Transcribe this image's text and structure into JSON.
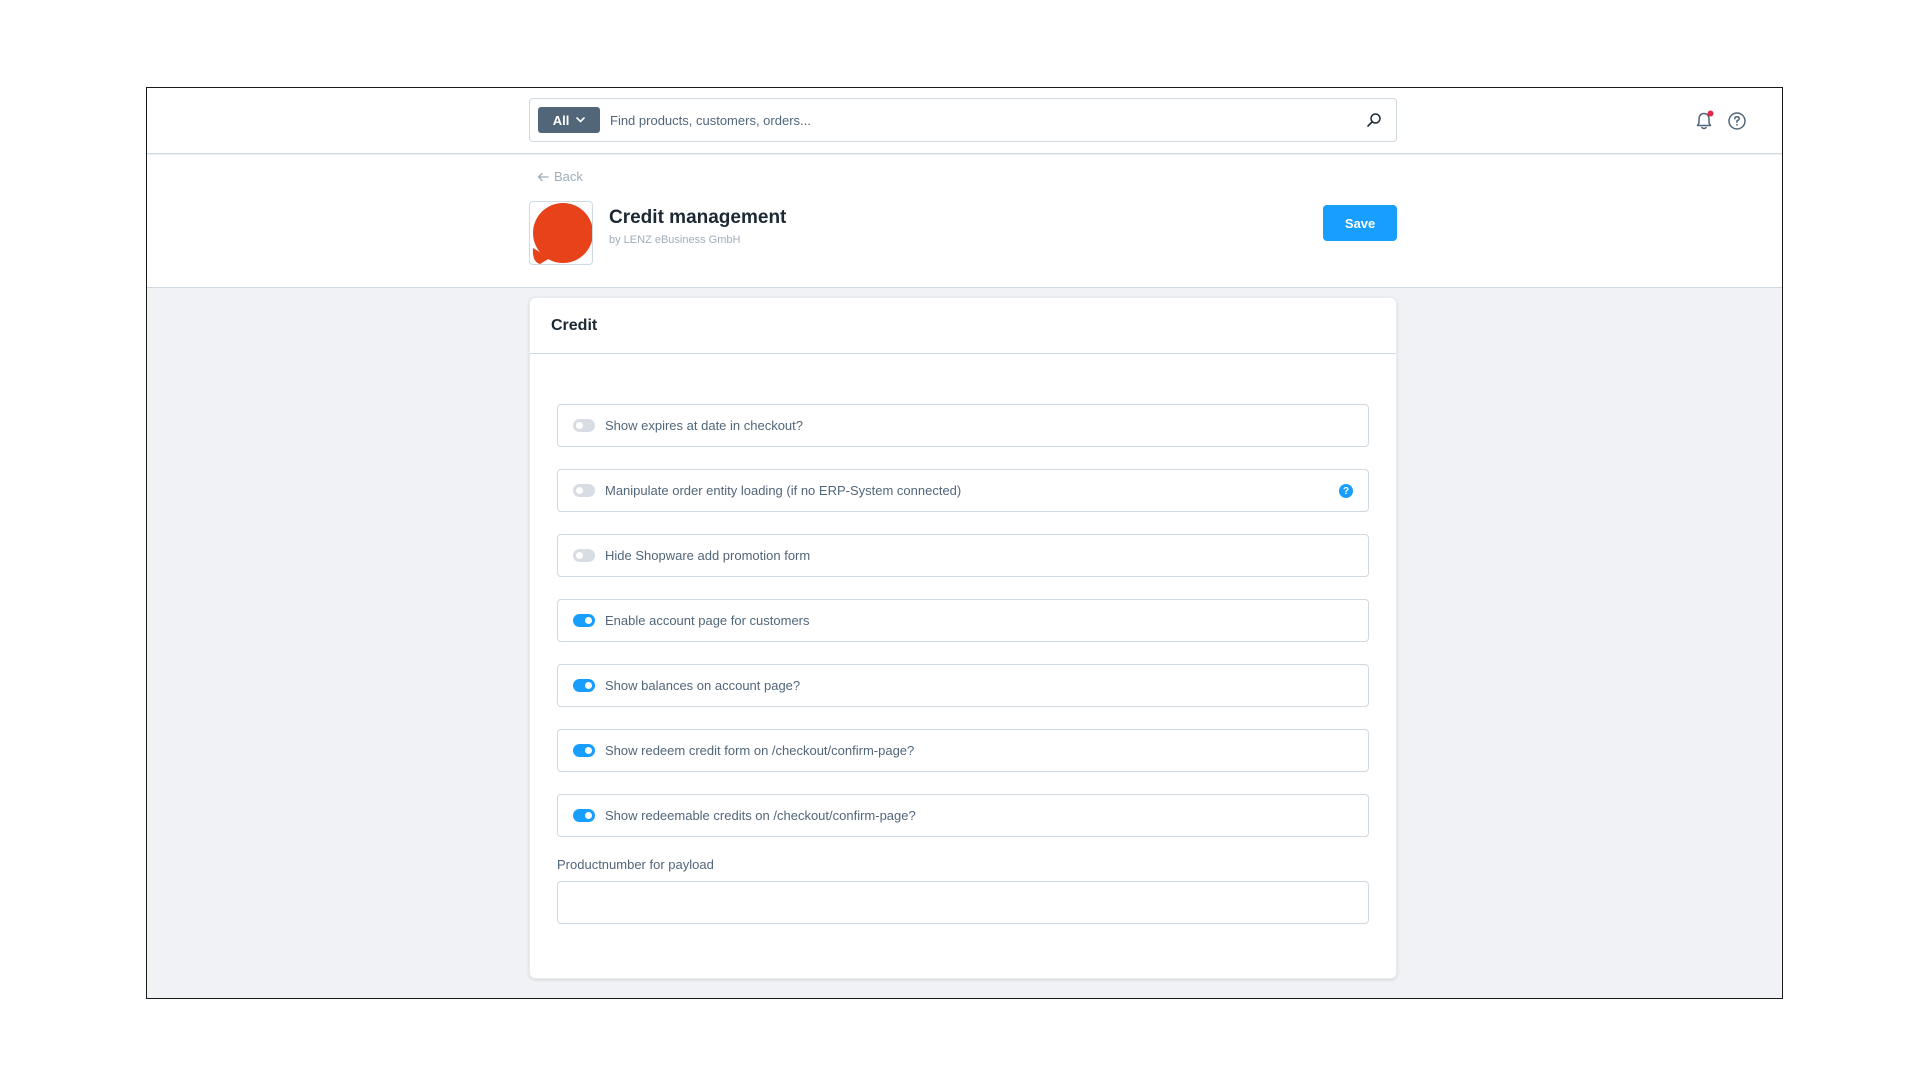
{
  "topbar": {
    "search_type": "All",
    "search_placeholder": "Find products, customers, orders...",
    "notification_dot_color": "#de294c"
  },
  "header": {
    "back_label": "Back",
    "title": "Credit management",
    "subtitle": "by LENZ eBusiness GmbH",
    "save_label": "Save",
    "logo_color": "#e8421a"
  },
  "card": {
    "title": "Credit",
    "switches": [
      {
        "label": "Show expires at date in checkout?",
        "enabled": false,
        "help": false
      },
      {
        "label": "Manipulate order entity loading (if no ERP-System connected)",
        "enabled": false,
        "help": true
      },
      {
        "label": "Hide Shopware add promotion form",
        "enabled": false,
        "help": false
      },
      {
        "label": "Enable account page for customers",
        "enabled": true,
        "help": false
      },
      {
        "label": "Show balances on account page?",
        "enabled": true,
        "help": false
      },
      {
        "label": "Show redeem credit form on /checkout/confirm-page?",
        "enabled": true,
        "help": false
      },
      {
        "label": "Show redeemable credits on /checkout/confirm-page?",
        "enabled": true,
        "help": false
      }
    ],
    "productnumber": {
      "label": "Productnumber for payload",
      "value": ""
    }
  },
  "colors": {
    "primary": "#189eff",
    "text": "#52667a",
    "heading": "#1c2833",
    "border": "#d1d9e0"
  }
}
